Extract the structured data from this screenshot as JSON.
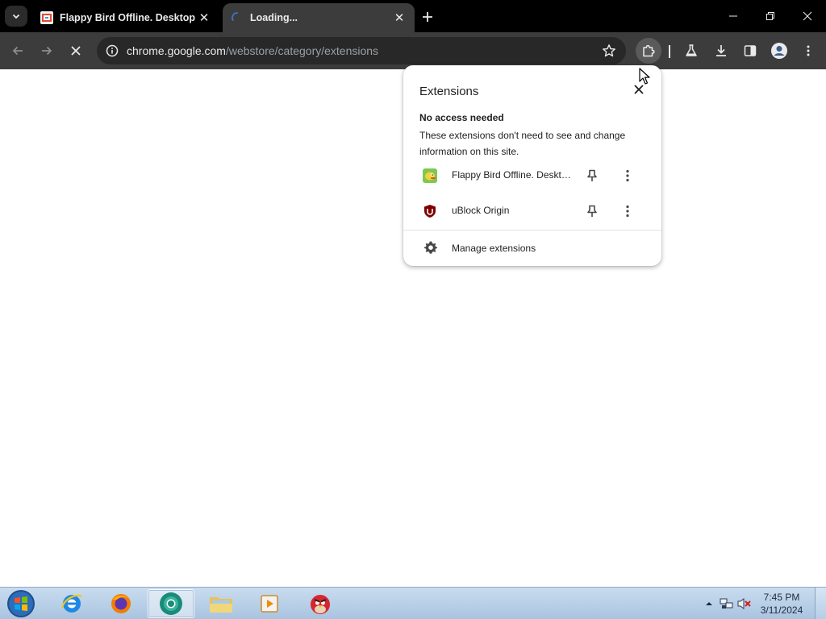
{
  "browser": {
    "tabs": [
      {
        "title": "Flappy Bird Offline. Desktop Version",
        "state": "inactive"
      },
      {
        "title": "Loading...",
        "state": "active"
      }
    ],
    "address": {
      "host": "chrome.google.com",
      "path": "/webstore/category/extensions"
    },
    "window_controls": [
      "minimize",
      "restore",
      "close"
    ],
    "toolbar_icons": [
      "back-arrow-icon",
      "forward-arrow-icon",
      "stop-loading-icon",
      "info-icon",
      "bookmark-star-icon",
      "extensions-puzzle-icon",
      "labs-flask-icon",
      "download-icon",
      "side-panel-icon",
      "profile-icon",
      "menu-kebab-icon"
    ]
  },
  "extensions_popup": {
    "title": "Extensions",
    "section_heading": "No access needed",
    "section_description": "These extensions don't need to see and change information on this site.",
    "items": [
      {
        "name": "Flappy Bird Offline. Desktop Version",
        "icon": "flappy-bird-icon"
      },
      {
        "name": "uBlock Origin",
        "icon": "ublock-origin-icon"
      }
    ],
    "manage_label": "Manage extensions"
  },
  "taskbar": {
    "apps": [
      "internet-explorer",
      "firefox",
      "chrome-beta",
      "file-explorer",
      "media-player",
      "angry-birds"
    ],
    "active_app": "chrome-beta",
    "clock": {
      "time": "7:45 PM",
      "date": "3/11/2024"
    }
  },
  "colors": {
    "tabstrip": "#000000",
    "toolbar": "#3c3c3c",
    "omnibox": "#282828",
    "popup_bg": "#ffffff",
    "taskbar": "#b8d0e8"
  }
}
